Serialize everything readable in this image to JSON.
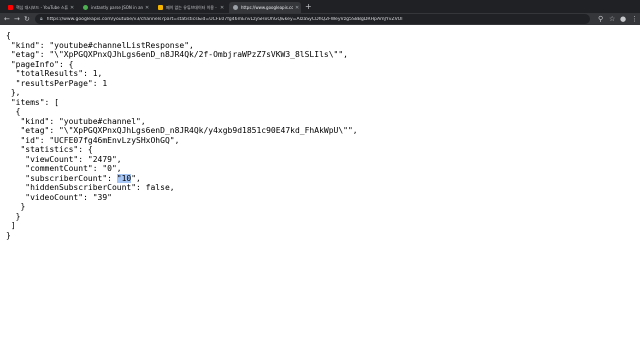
{
  "tabs": [
    {
      "title": "핵심 대시보드 - YouTube 스튜디오",
      "icon": "youtube-studio-icon",
      "color": "#ff0000",
      "active": false
    },
    {
      "title": "instantly parse JSON in any la",
      "icon": "quicktype-icon",
      "color": "#4caf50",
      "active": false
    },
    {
      "title": "페이 없는 유튜브데이터 이용 - Go",
      "icon": "doc-icon",
      "color": "#f4b400",
      "active": false
    },
    {
      "title": "https://www.googleapis.com/yo",
      "icon": "globe-icon",
      "color": "#9aa0a6",
      "active": true
    }
  ],
  "address_bar": {
    "url": "https://www.googleapis.com/youtube/v3/channels?part=statistics&id=UCFE07fg46mEnvLzySHxOhGQ&key=AIzaSyCDhQ2FWeyVzg5S8BgDRHpAmJYvZVOl"
  },
  "json_text": {
    "line1": "{",
    "line2": " \"kind\": \"youtube#channelListResponse\",",
    "line3": " \"etag\": \"\\\"XpPGQXPnxQJhLgs6enD_n8JR4Qk/2f-OmbjraWPzZ7sVKW3_8lSLIls\\\"\",",
    "line4": " \"pageInfo\": {",
    "line5": "  \"totalResults\": 1,",
    "line6": "  \"resultsPerPage\": 1",
    "line7": " },",
    "line8": " \"items\": [",
    "line9": "  {",
    "line10": "   \"kind\": \"youtube#channel\",",
    "line11": "   \"etag\": \"\\\"XpPGQXPnxQJhLgs6enD_n8JR4Qk/y4xgb9d1851c90E47kd_FhAkWpU\\\"\",",
    "line12": "   \"id\": \"UCFE07fg46mEnvLzySHxOhGQ\",",
    "line13": "   \"statistics\": {",
    "line14": "    \"viewCount\": \"2479\",",
    "line15a": "    \"commentCount\": \"0\",",
    "line16_pre": "    \"subscriberCount\": ",
    "line16_sel": "\"10",
    "line16_post": "\",",
    "line17": "    \"hiddenSubscriberCount\": false,",
    "line18": "    \"videoCount\": \"39\"",
    "line19": "   }",
    "line20": "  }",
    "line21": " ]",
    "line22": "}"
  }
}
